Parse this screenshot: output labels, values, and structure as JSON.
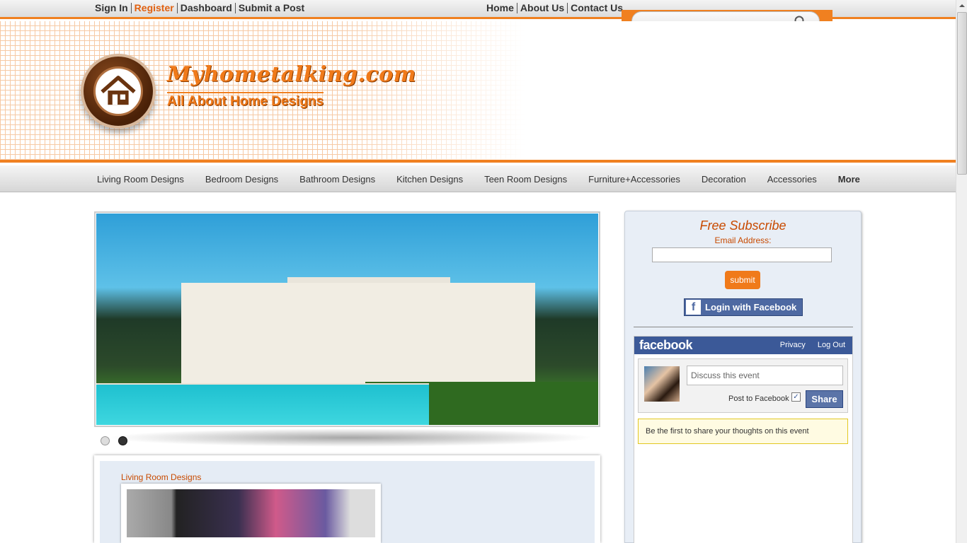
{
  "topbar": {
    "left_links": [
      {
        "label": "Sign In",
        "accent": false
      },
      {
        "label": "Register",
        "accent": true
      },
      {
        "label": "Dashboard",
        "accent": false
      },
      {
        "label": "Submit a Post",
        "accent": false
      }
    ],
    "right_links": [
      "Home",
      "About Us",
      "Contact Us"
    ],
    "search": {
      "placeholder": "",
      "icon": "search-icon"
    }
  },
  "header": {
    "site_name": "Myhometalking.com",
    "tagline": "All About Home Designs",
    "logo_icon": "house-icon"
  },
  "nav": {
    "items": [
      "Living Room Designs",
      "Bedroom Designs",
      "Bathroom Designs",
      "Kitchen Designs",
      "Teen Room Designs",
      "Furniture+Accessories",
      "Decoration",
      "Accessories",
      "More"
    ]
  },
  "slider": {
    "dots": 2,
    "active_dot": 2
  },
  "post": {
    "category": "Living Room Designs"
  },
  "sidebar": {
    "subscribe_title": "Free Subscribe",
    "email_label": "Email Address:",
    "submit_label": "submit",
    "fb_login_label": "Login with Facebook",
    "facebook": {
      "logo": "facebook",
      "privacy": "Privacy",
      "logout": "Log Out",
      "comment_placeholder": "Discuss this event",
      "post_to_label": "Post to Facebook",
      "share_label": "Share",
      "first_message": "Be the first to share your thoughts on this event"
    }
  },
  "colors": {
    "accent": "#f08020",
    "facebook": "#3b5998",
    "link_orange": "#c84a00"
  }
}
